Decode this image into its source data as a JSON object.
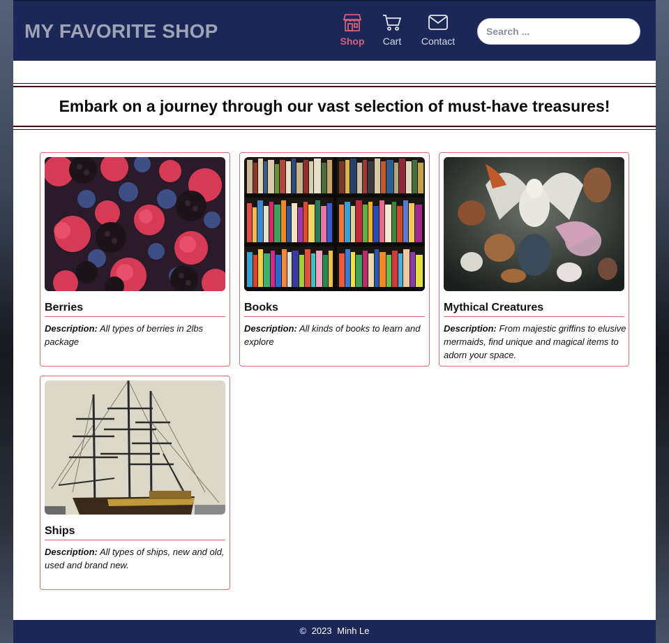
{
  "brand": {
    "title": "MY FAVORITE SHOP"
  },
  "nav": [
    {
      "label": "Shop",
      "icon": "shop-icon",
      "active": true
    },
    {
      "label": "Cart",
      "icon": "cart-icon",
      "active": false
    },
    {
      "label": "Contact",
      "icon": "mail-icon",
      "active": false
    }
  ],
  "search": {
    "placeholder": "Search ...",
    "value": ""
  },
  "banner": {
    "text": "Embark on a journey through our vast selection of must-have treasures!"
  },
  "products": [
    {
      "title": "Berries",
      "desc_label": "Description:",
      "desc": "All types of berries in 2lbs package"
    },
    {
      "title": "Books",
      "desc_label": "Description:",
      "desc": "All kinds of books to learn and explore"
    },
    {
      "title": "Mythical Creatures",
      "desc_label": "Description:",
      "desc": "From majestic griffins to elusive mermaids, find unique and magical items to adorn your space."
    },
    {
      "title": "Ships",
      "desc_label": "Description:",
      "desc": "All types of ships, new and old, used and brand new."
    }
  ],
  "footer": {
    "copyright": "©",
    "year": "2023",
    "author": "Minh Le"
  },
  "colors": {
    "header_bg": "#1b2757",
    "accent": "#d4607a",
    "card_border": "#e06b74"
  }
}
